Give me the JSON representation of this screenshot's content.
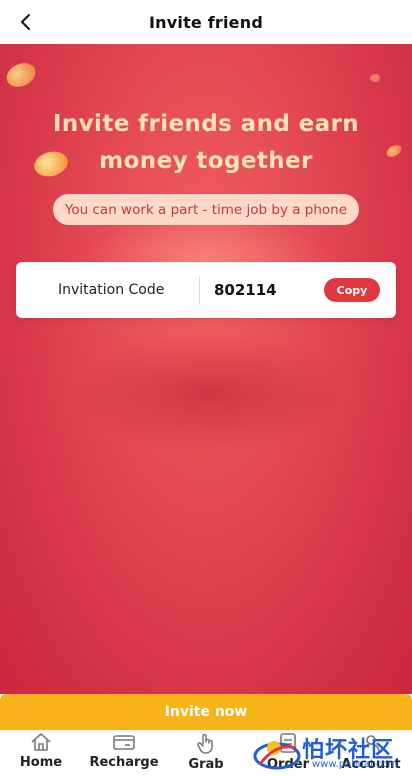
{
  "header": {
    "title": "Invite friend"
  },
  "hero": {
    "headline_line1": "Invite friends and earn",
    "headline_line2": "money together",
    "subtitle": "You can work a part - time job by a phone"
  },
  "invitation": {
    "label": "Invitation Code",
    "code": "802114",
    "copy_label": "Copy"
  },
  "cta": {
    "invite_label": "Invite now"
  },
  "tabbar": {
    "items": [
      {
        "label": "Home",
        "icon": "home-icon"
      },
      {
        "label": "Recharge",
        "icon": "recharge-icon"
      },
      {
        "label": "Grab",
        "icon": "grab-hand-icon"
      },
      {
        "label": "Order",
        "icon": "order-icon"
      },
      {
        "label": "Account",
        "icon": "account-icon"
      }
    ]
  },
  "watermark": {
    "text": "怕坏社区",
    "url": "www.pahuai.com"
  },
  "colors": {
    "hero_red": "#e54b55",
    "headline_gold": "#fbe3b6",
    "copy_button": "#e0383e",
    "invite_button": "#f8b21a"
  }
}
